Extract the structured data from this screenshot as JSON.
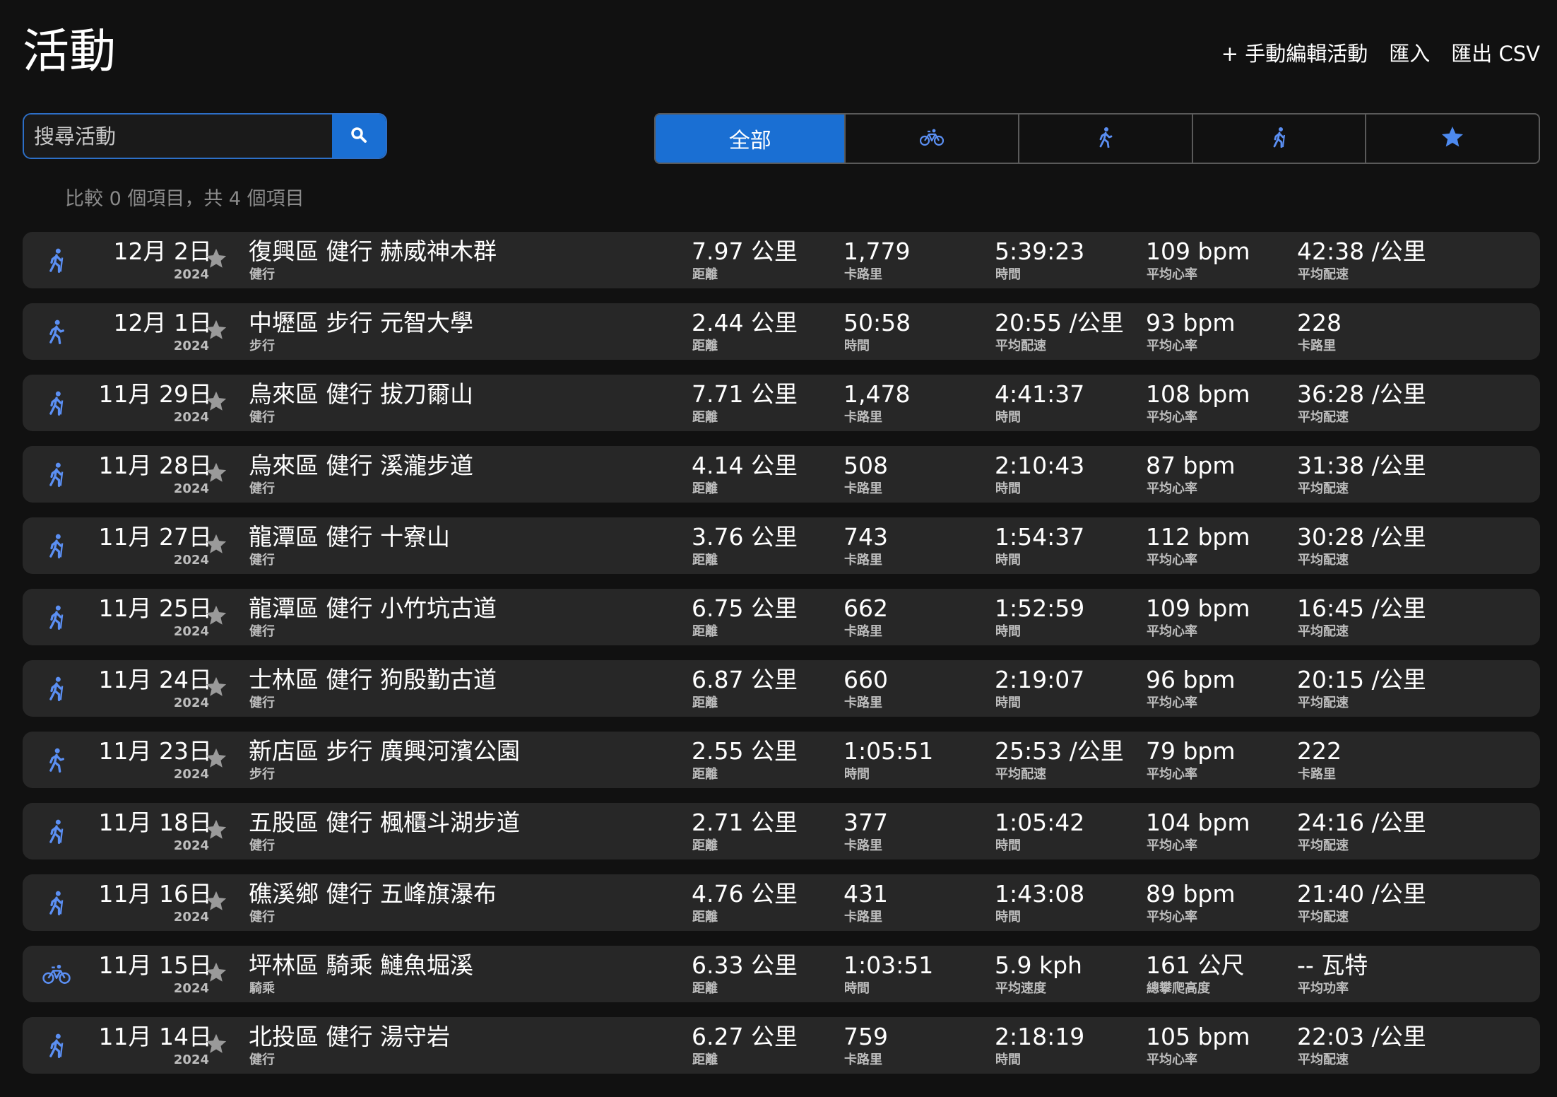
{
  "header": {
    "title": "活動",
    "actions": [
      "+ 手動編輯活動",
      "匯入",
      "匯出 CSV"
    ]
  },
  "search": {
    "placeholder": "搜尋活動",
    "icon": "search-icon"
  },
  "filters": {
    "all_label": "全部",
    "icons": [
      "bike-icon",
      "walk-icon",
      "hike-icon",
      "star-icon"
    ]
  },
  "compare_text": "比較 0 個項目，共 4 個項目",
  "colors": {
    "accent": "#1a6fd3",
    "icon_blue": "#5b8ff3",
    "star_gray": "#9a9a9a"
  },
  "activities": [
    {
      "icon": "hike-icon",
      "date": "12月 2日",
      "year": "2024",
      "name": "復興區 健行 赫威神木群",
      "type": "健行",
      "stats": [
        [
          "7.97 公里",
          "距離"
        ],
        [
          "1,779",
          "卡路里"
        ],
        [
          "5:39:23",
          "時間"
        ],
        [
          "109 bpm",
          "平均心率"
        ],
        [
          "42:38 /公里",
          "平均配速"
        ]
      ]
    },
    {
      "icon": "walk-icon",
      "date": "12月 1日",
      "year": "2024",
      "name": "中壢區 步行 元智大學",
      "type": "步行",
      "stats": [
        [
          "2.44 公里",
          "距離"
        ],
        [
          "50:58",
          "時間"
        ],
        [
          "20:55 /公里",
          "平均配速"
        ],
        [
          "93 bpm",
          "平均心率"
        ],
        [
          "228",
          "卡路里"
        ]
      ]
    },
    {
      "icon": "hike-icon",
      "date": "11月 29日",
      "year": "2024",
      "name": "烏來區 健行 拔刀爾山",
      "type": "健行",
      "stats": [
        [
          "7.71 公里",
          "距離"
        ],
        [
          "1,478",
          "卡路里"
        ],
        [
          "4:41:37",
          "時間"
        ],
        [
          "108 bpm",
          "平均心率"
        ],
        [
          "36:28 /公里",
          "平均配速"
        ]
      ]
    },
    {
      "icon": "hike-icon",
      "date": "11月 28日",
      "year": "2024",
      "name": "烏來區 健行 溪瀧步道",
      "type": "健行",
      "stats": [
        [
          "4.14 公里",
          "距離"
        ],
        [
          "508",
          "卡路里"
        ],
        [
          "2:10:43",
          "時間"
        ],
        [
          "87 bpm",
          "平均心率"
        ],
        [
          "31:38 /公里",
          "平均配速"
        ]
      ]
    },
    {
      "icon": "hike-icon",
      "date": "11月 27日",
      "year": "2024",
      "name": "龍潭區 健行 十寮山",
      "type": "健行",
      "stats": [
        [
          "3.76 公里",
          "距離"
        ],
        [
          "743",
          "卡路里"
        ],
        [
          "1:54:37",
          "時間"
        ],
        [
          "112 bpm",
          "平均心率"
        ],
        [
          "30:28 /公里",
          "平均配速"
        ]
      ]
    },
    {
      "icon": "hike-icon",
      "date": "11月 25日",
      "year": "2024",
      "name": "龍潭區 健行 小竹坑古道",
      "type": "健行",
      "stats": [
        [
          "6.75 公里",
          "距離"
        ],
        [
          "662",
          "卡路里"
        ],
        [
          "1:52:59",
          "時間"
        ],
        [
          "109 bpm",
          "平均心率"
        ],
        [
          "16:45 /公里",
          "平均配速"
        ]
      ]
    },
    {
      "icon": "hike-icon",
      "date": "11月 24日",
      "year": "2024",
      "name": "士林區 健行 狗殷勤古道",
      "type": "健行",
      "stats": [
        [
          "6.87 公里",
          "距離"
        ],
        [
          "660",
          "卡路里"
        ],
        [
          "2:19:07",
          "時間"
        ],
        [
          "96 bpm",
          "平均心率"
        ],
        [
          "20:15 /公里",
          "平均配速"
        ]
      ]
    },
    {
      "icon": "walk-icon",
      "date": "11月 23日",
      "year": "2024",
      "name": "新店區 步行 廣興河濱公園",
      "type": "步行",
      "stats": [
        [
          "2.55 公里",
          "距離"
        ],
        [
          "1:05:51",
          "時間"
        ],
        [
          "25:53 /公里",
          "平均配速"
        ],
        [
          "79 bpm",
          "平均心率"
        ],
        [
          "222",
          "卡路里"
        ]
      ]
    },
    {
      "icon": "hike-icon",
      "date": "11月 18日",
      "year": "2024",
      "name": "五股區 健行 楓櫃斗湖步道",
      "type": "健行",
      "stats": [
        [
          "2.71 公里",
          "距離"
        ],
        [
          "377",
          "卡路里"
        ],
        [
          "1:05:42",
          "時間"
        ],
        [
          "104 bpm",
          "平均心率"
        ],
        [
          "24:16 /公里",
          "平均配速"
        ]
      ]
    },
    {
      "icon": "hike-icon",
      "date": "11月 16日",
      "year": "2024",
      "name": "礁溪鄉 健行 五峰旗瀑布",
      "type": "健行",
      "stats": [
        [
          "4.76 公里",
          "距離"
        ],
        [
          "431",
          "卡路里"
        ],
        [
          "1:43:08",
          "時間"
        ],
        [
          "89 bpm",
          "平均心率"
        ],
        [
          "21:40 /公里",
          "平均配速"
        ]
      ]
    },
    {
      "icon": "bike-icon",
      "date": "11月 15日",
      "year": "2024",
      "name": "坪林區 騎乘 鰱魚堀溪",
      "type": "騎乘",
      "stats": [
        [
          "6.33 公里",
          "距離"
        ],
        [
          "1:03:51",
          "時間"
        ],
        [
          "5.9 kph",
          "平均速度"
        ],
        [
          "161 公尺",
          "總攀爬高度"
        ],
        [
          "-- 瓦特",
          "平均功率"
        ]
      ]
    },
    {
      "icon": "hike-icon",
      "date": "11月 14日",
      "year": "2024",
      "name": "北投區 健行 湯守岩",
      "type": "健行",
      "stats": [
        [
          "6.27 公里",
          "距離"
        ],
        [
          "759",
          "卡路里"
        ],
        [
          "2:18:19",
          "時間"
        ],
        [
          "105 bpm",
          "平均心率"
        ],
        [
          "22:03 /公里",
          "平均配速"
        ]
      ]
    }
  ]
}
